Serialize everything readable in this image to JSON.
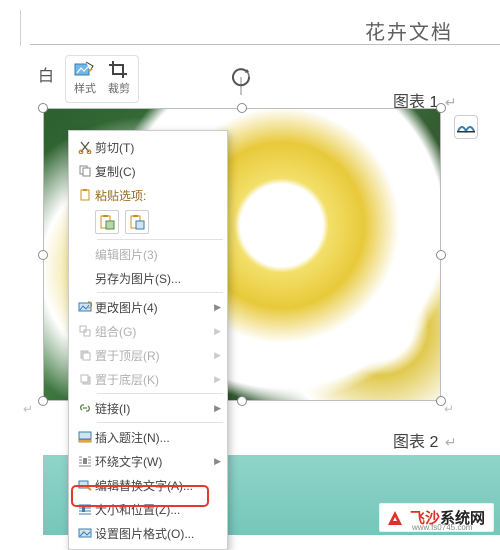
{
  "doc_title": "花卉文档",
  "whitebutton": "白",
  "toolbar": {
    "style": "样式",
    "crop": "裁剪"
  },
  "caption1": {
    "label": "图表",
    "num": "1",
    "mark": "↵"
  },
  "caption2": {
    "label": "图表",
    "num": "2",
    "mark": "↵"
  },
  "context_menu": {
    "cut": "剪切(T)",
    "copy": "复制(C)",
    "paste_options": "粘贴选项:",
    "edit_picture": "编辑图片(3)",
    "save_as_picture": "另存为图片(S)...",
    "change_picture": "更改图片(4)",
    "group": "组合(G)",
    "bring_front": "置于顶层(R)",
    "send_back": "置于底层(K)",
    "link": "链接(I)",
    "insert_caption": "插入题注(N)...",
    "wrap_text": "环绕文字(W)",
    "edit_alt_text": "编辑替换文字(A)...",
    "size_position": "大小和位置(Z)...",
    "format_picture": "设置图片格式(O)..."
  },
  "watermark": {
    "brand1": "飞沙",
    "brand2": "系统网",
    "url": "www.fs0745.com"
  },
  "pilcrow": "↵"
}
